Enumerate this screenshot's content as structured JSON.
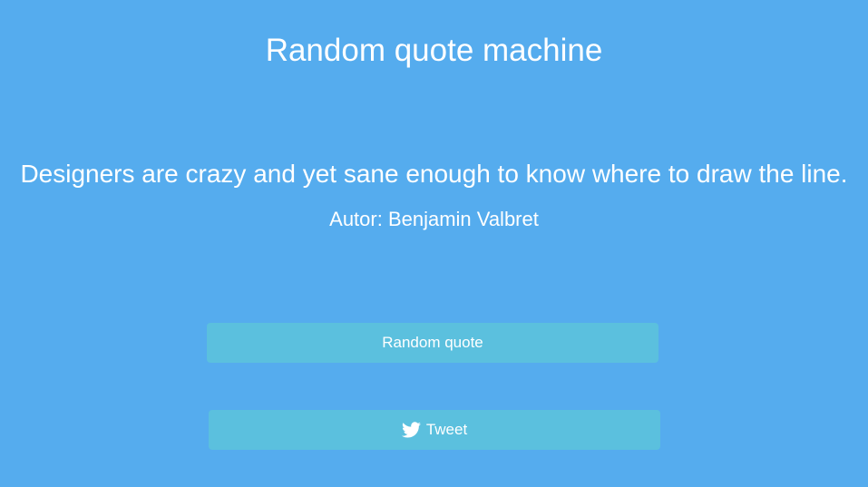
{
  "page": {
    "title": "Random quote machine"
  },
  "quote": {
    "text": "Designers are crazy and yet sane enough to know where to draw the line.",
    "author": "Autor: Benjamin Valbret"
  },
  "buttons": {
    "random_label": "Random quote",
    "tweet_label": "Tweet",
    "tweet_icon": "twitter-bird-icon"
  },
  "colors": {
    "background": "#55acee",
    "button": "#5bc0de",
    "text": "#ffffff"
  }
}
